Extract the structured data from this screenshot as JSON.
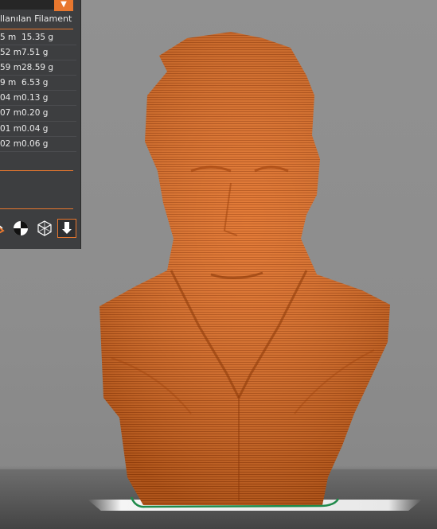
{
  "panel": {
    "title": "llanılan Filament",
    "dropdown_icon": "chevron-down-icon",
    "accent_color": "#e8772e",
    "rows": [
      {
        "length": "5 m",
        "weight": "15.35 g"
      },
      {
        "length": "52 m",
        "weight": "7.51 g"
      },
      {
        "length": "59 m",
        "weight": "28.59 g"
      },
      {
        "length": "9 m",
        "weight": "6.53 g"
      },
      {
        "length": "04 m",
        "weight": "0.13 g"
      },
      {
        "length": "07 m",
        "weight": "0.20 g"
      },
      {
        "length": "01 m",
        "weight": "0.04 g"
      },
      {
        "length": "02 m",
        "weight": "0.06 g"
      }
    ],
    "tool_icons": [
      "color-ring-icon",
      "shading-icon",
      "wireframe-cube-icon",
      "download-icon"
    ]
  },
  "viewport": {
    "model": "sliced-bust-model",
    "model_color": "#e06d22",
    "bed_outline_color": "#1f8a4a"
  }
}
